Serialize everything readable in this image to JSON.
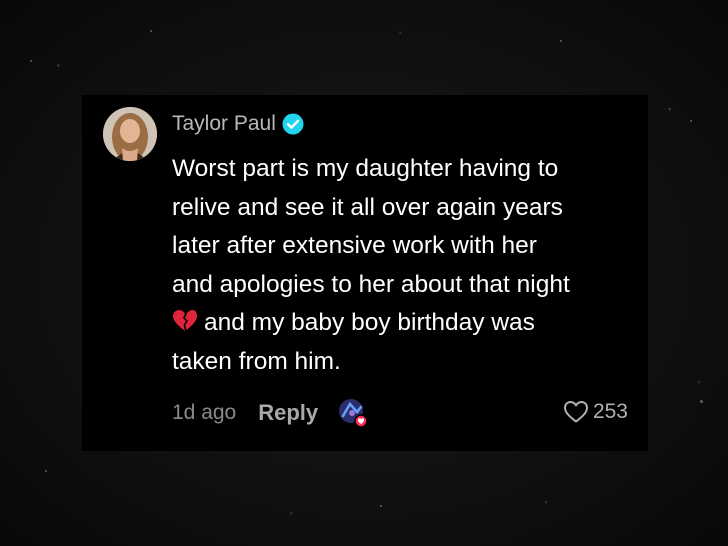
{
  "comment": {
    "author": "Taylor Paul",
    "lines": [
      "Worst part is my daughter having to",
      "relive and see it all over again years",
      "later after extensive work with her",
      "and apologies to her about that night",
      "and my baby boy birthday was",
      "taken from him."
    ],
    "emoji": "broken-heart-icon",
    "time_ago": "1d ago",
    "reply_label": "Reply",
    "like_count": "253"
  },
  "colors": {
    "card_background": "#000000",
    "verified_badge": "#20d5ec",
    "like_badge": "#fe2c55",
    "broken_heart": "#e0243a"
  }
}
